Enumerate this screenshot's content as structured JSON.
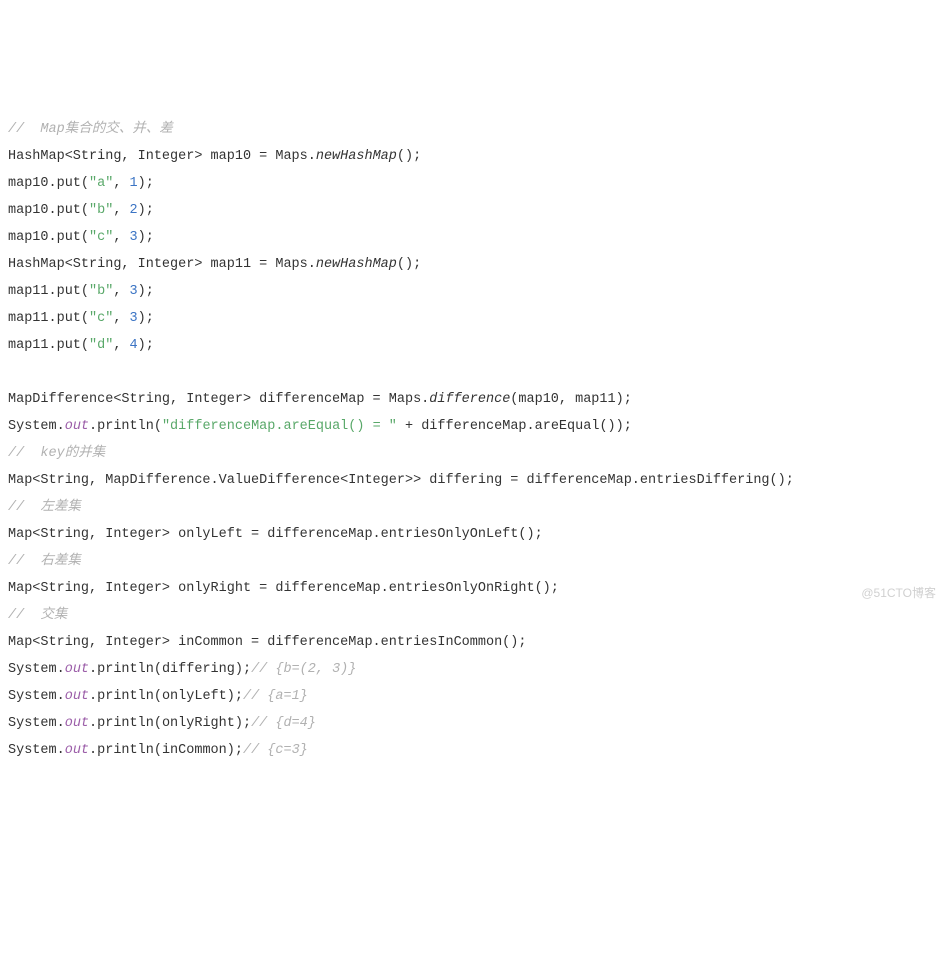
{
  "code": {
    "c1": "//  Map集合的交、并、差",
    "l2_a": "HashMap<String, Integer> map10 = Maps.",
    "l2_m": "newHashMap",
    "l2_b": "();",
    "l3_a": "map10.put(",
    "l3_s": "\"a\"",
    "l3_c": ", ",
    "l3_n": "1",
    "l3_e": ");",
    "l4_a": "map10.put(",
    "l4_s": "\"b\"",
    "l4_c": ", ",
    "l4_n": "2",
    "l4_e": ");",
    "l5_a": "map10.put(",
    "l5_s": "\"c\"",
    "l5_c": ", ",
    "l5_n": "3",
    "l5_e": ");",
    "l6_a": "HashMap<String, Integer> map11 = Maps.",
    "l6_m": "newHashMap",
    "l6_b": "();",
    "l7_a": "map11.put(",
    "l7_s": "\"b\"",
    "l7_c": ", ",
    "l7_n": "3",
    "l7_e": ");",
    "l8_a": "map11.put(",
    "l8_s": "\"c\"",
    "l8_c": ", ",
    "l8_n": "3",
    "l8_e": ");",
    "l9_a": "map11.put(",
    "l9_s": "\"d\"",
    "l9_c": ", ",
    "l9_n": "4",
    "l9_e": ");",
    "l11_a": "MapDifference<String, Integer> differenceMap = Maps.",
    "l11_m": "difference",
    "l11_b": "(map10, map11);",
    "l12_a": "System.",
    "l12_f": "out",
    "l12_b": ".println(",
    "l12_s": "\"differenceMap.areEqual() = \"",
    "l12_c": " + differenceMap.areEqual());",
    "c13": "//  key的并集",
    "l14": "Map<String, MapDifference.ValueDifference<Integer>> differing = differenceMap.entriesDiffering();",
    "c15": "//  左差集",
    "l16": "Map<String, Integer> onlyLeft = differenceMap.entriesOnlyOnLeft();",
    "c17": "//  右差集",
    "l18": "Map<String, Integer> onlyRight = differenceMap.entriesOnlyOnRight();",
    "c19": "//  交集",
    "l20": "Map<String, Integer> inCommon = differenceMap.entriesInCommon();",
    "l21_a": "System.",
    "l21_f": "out",
    "l21_b": ".println(differing);",
    "l21_c": "// {b=(2, 3)}",
    "l22_a": "System.",
    "l22_f": "out",
    "l22_b": ".println(onlyLeft);",
    "l22_c": "// {a=1}",
    "l23_a": "System.",
    "l23_f": "out",
    "l23_b": ".println(onlyRight);",
    "l23_c": "// {d=4}",
    "l24_a": "System.",
    "l24_f": "out",
    "l24_b": ".println(inCommon);",
    "l24_c": "// {c=3}"
  },
  "watermark": "@51CTO博客"
}
